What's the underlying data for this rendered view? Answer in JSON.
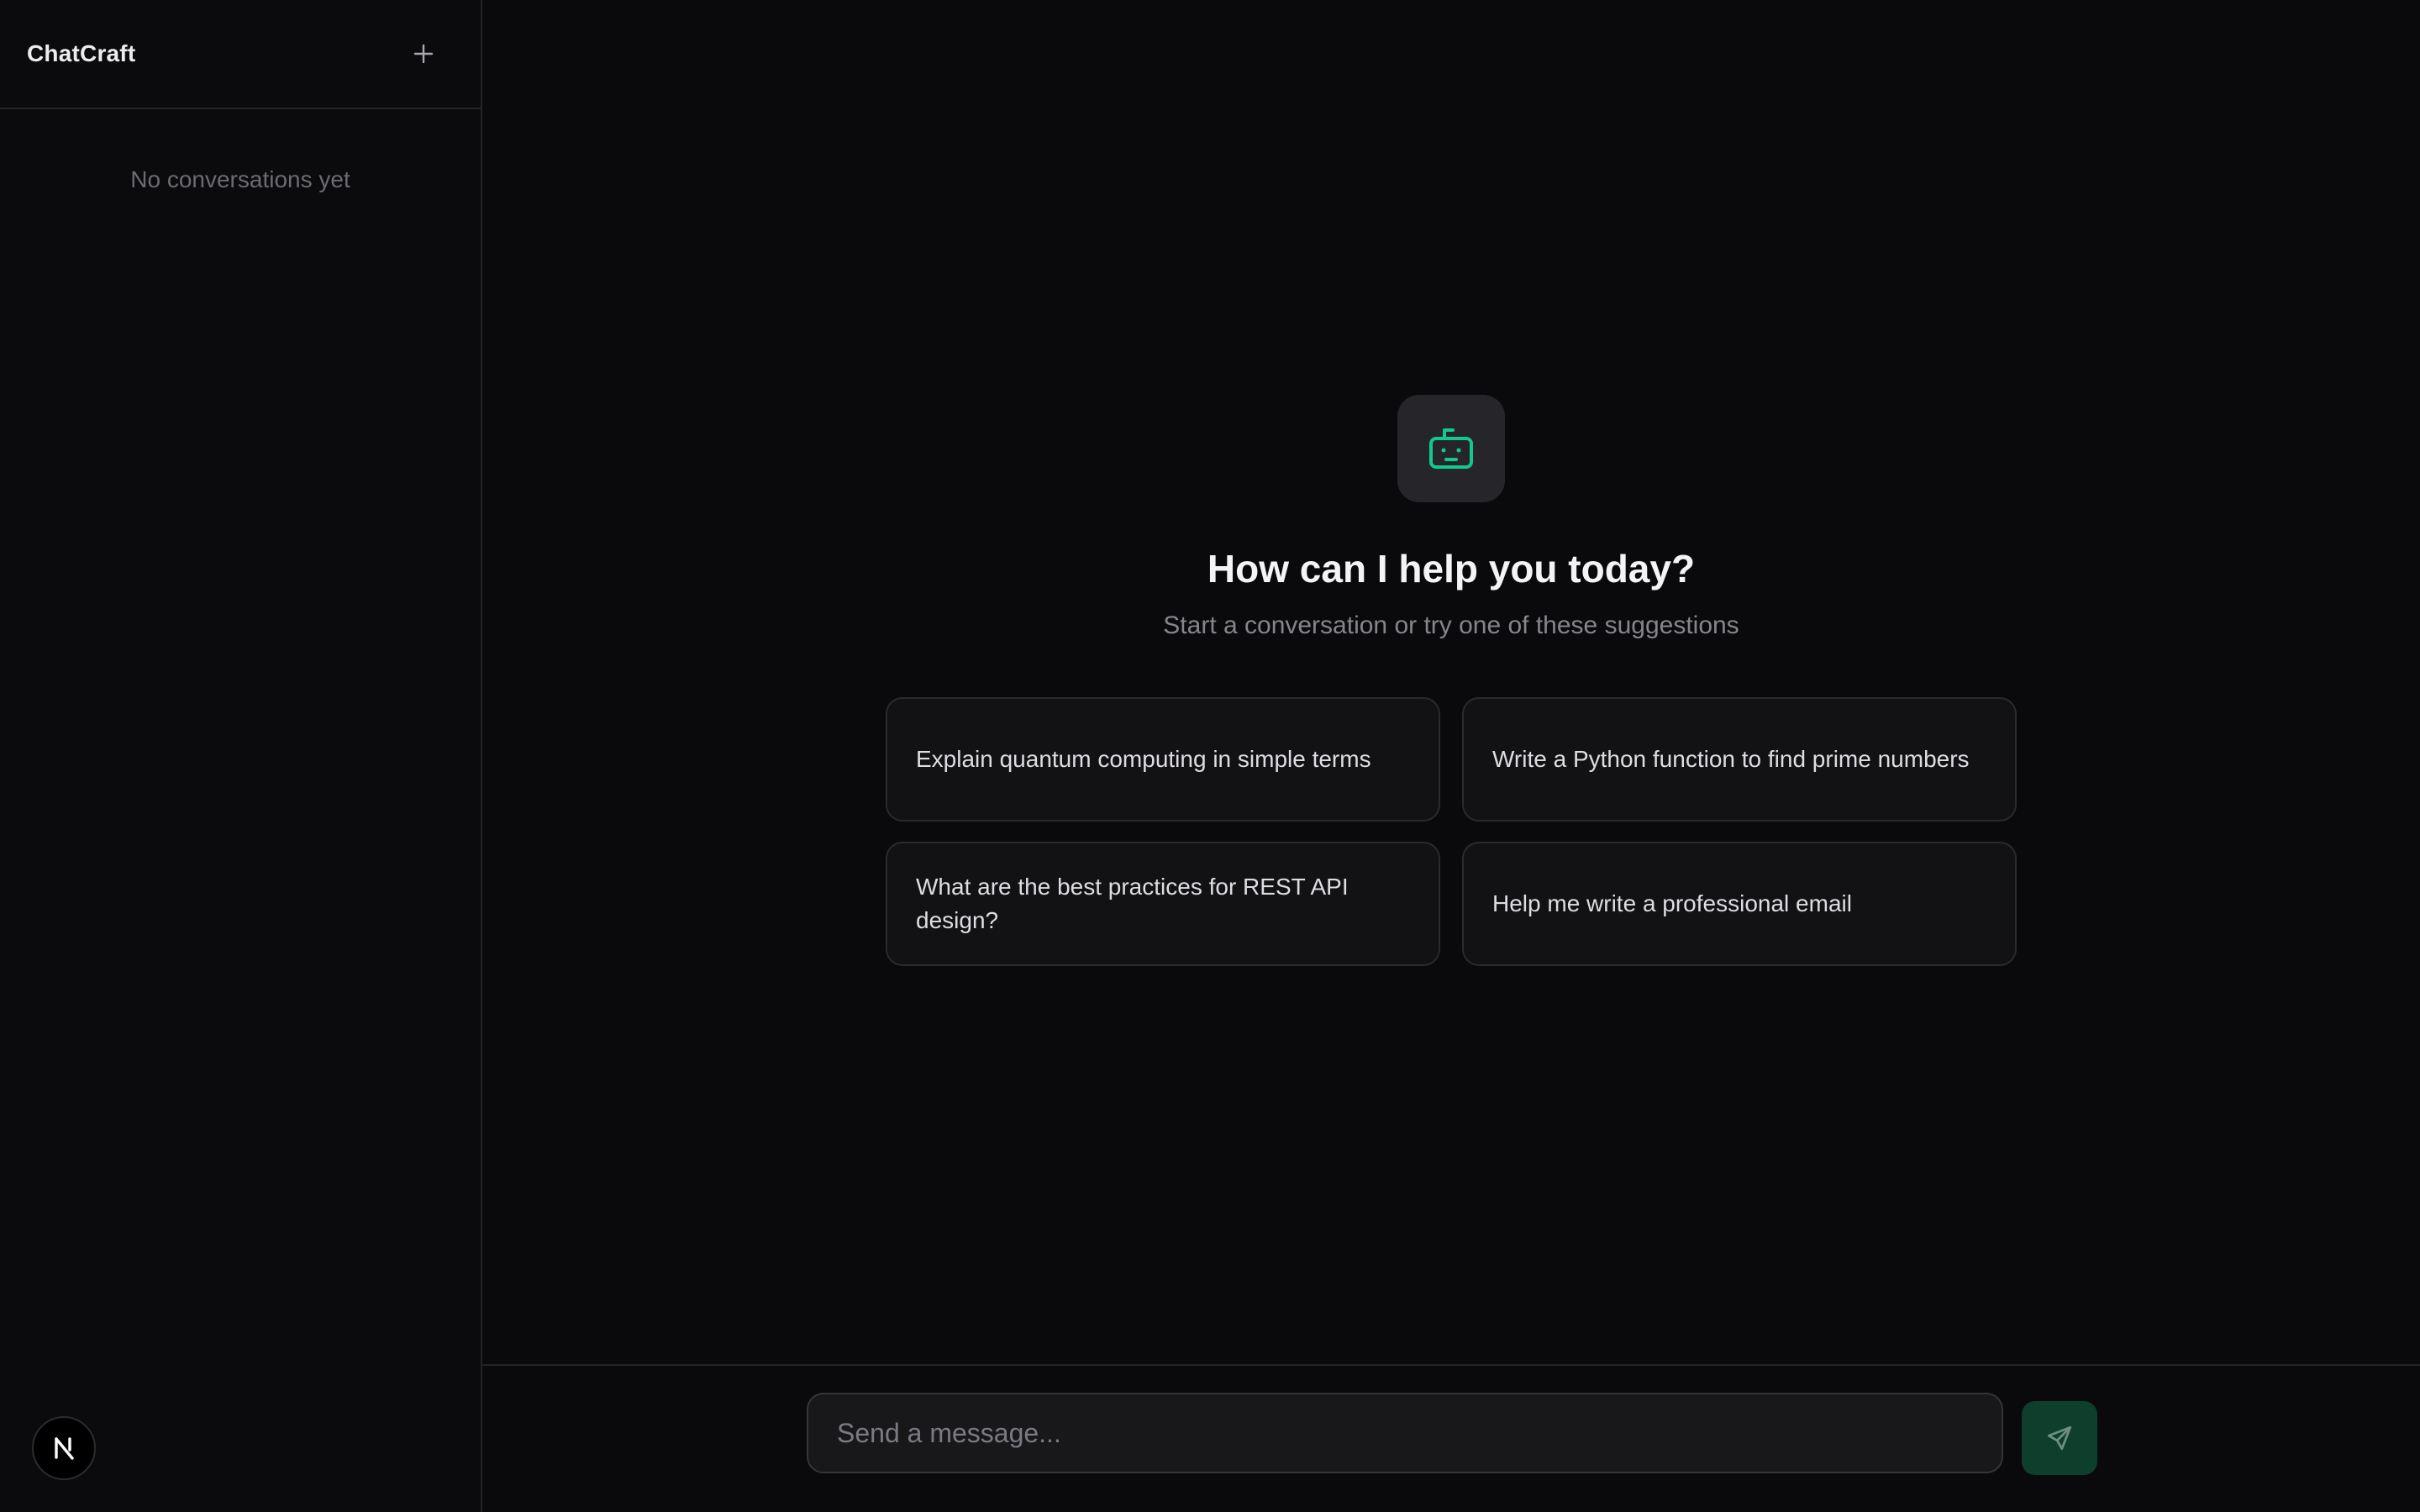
{
  "sidebar": {
    "brand": "ChatCraft",
    "new_chat_icon": "plus-icon",
    "empty_text": "No conversations yet",
    "avatar_letter": "N"
  },
  "main": {
    "icon": "bot-icon",
    "headline": "How can I help you today?",
    "subline": "Start a conversation or try one of these suggestions",
    "suggestions": [
      {
        "text": "Explain quantum computing in simple terms"
      },
      {
        "text": "Write a Python function to find prime numbers"
      },
      {
        "text": "What are the best practices for REST API design?"
      },
      {
        "text": "Help me write a professional email"
      }
    ]
  },
  "composer": {
    "placeholder": "Send a message...",
    "value": "",
    "send_icon": "send-icon"
  },
  "colors": {
    "accent": "#10c98f",
    "background": "#0a0a0c",
    "send_button": "#0d3f2c"
  }
}
